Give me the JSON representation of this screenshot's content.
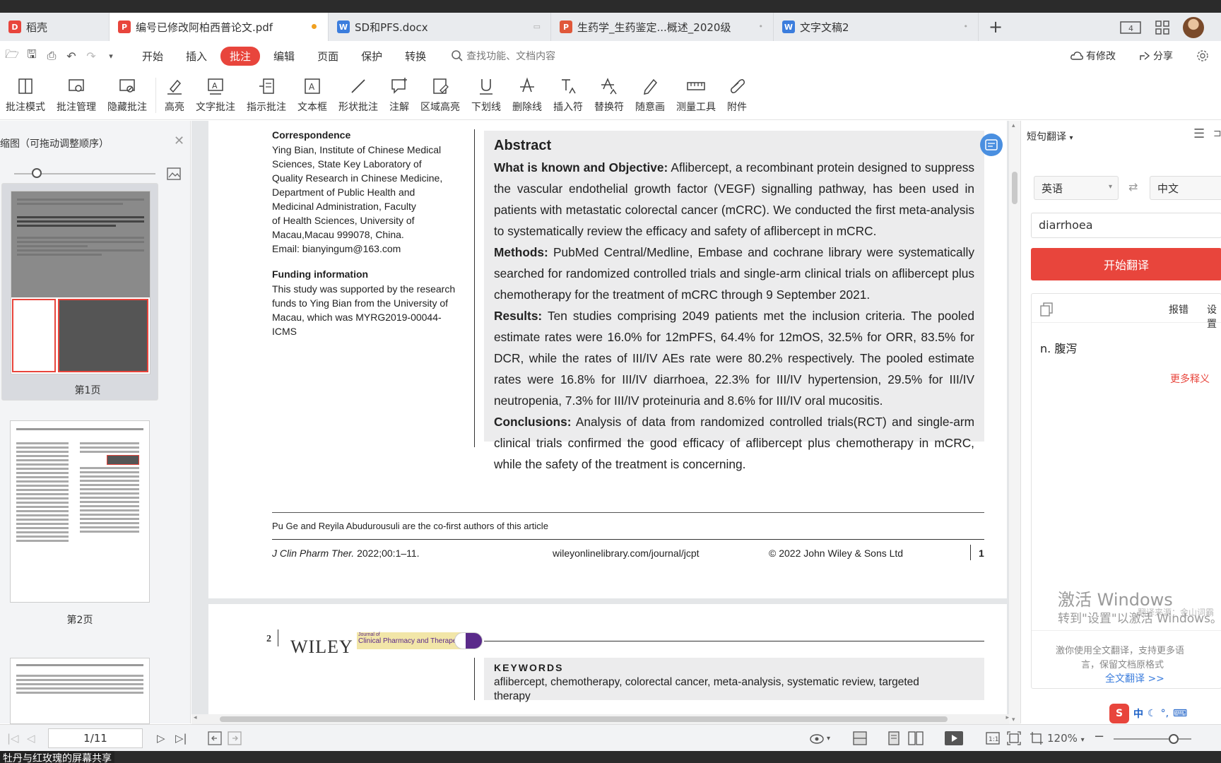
{
  "tabs": [
    {
      "label": "稻壳",
      "icon": "daoke-logo-icon",
      "color": "#e8453c",
      "active": false
    },
    {
      "label": "编号已修改阿柏西普论文.pdf",
      "icon": "pdf-icon",
      "color": "#e8453c",
      "active": true
    },
    {
      "label": "SD和PFS.docx",
      "icon": "word-icon",
      "color": "#3b7ddd",
      "active": false
    },
    {
      "label": "生药学_生药鉴定...概述_2020级",
      "icon": "ppt-icon",
      "color": "#e0583a",
      "active": false
    },
    {
      "label": "文字文稿2",
      "icon": "word-icon",
      "color": "#3b7ddd",
      "active": false
    }
  ],
  "menu": {
    "items": [
      "开始",
      "插入",
      "批注",
      "编辑",
      "页面",
      "保护",
      "转换"
    ],
    "active": "批注",
    "search_placeholder": "查找功能、文档内容",
    "modified_label": "有修改",
    "share_label": "分享"
  },
  "ribbon": [
    "批注模式",
    "批注管理",
    "隐藏批注",
    "高亮",
    "文字批注",
    "指示批注",
    "文本框",
    "形状批注",
    "注解",
    "区域高亮",
    "下划线",
    "删除线",
    "插入符",
    "替换符",
    "随意画",
    "测量工具",
    "附件"
  ],
  "left_panel": {
    "title": "缩图（可拖动调整顺序）",
    "pages": [
      {
        "label": "第1页"
      },
      {
        "label": "第2页"
      }
    ]
  },
  "document": {
    "correspondence": {
      "heading": "Correspondence",
      "lines": [
        "Ying Bian, Institute of Chinese Medical",
        "Sciences, State Key Laboratory of",
        "Quality Research in Chinese Medicine,",
        "Department of Public Health and",
        "Medicinal Administration, Faculty",
        "of Health Sciences, University of",
        "Macau,Macau 999078, China.",
        "Email: bianyingum@163.com"
      ]
    },
    "funding": {
      "heading": "Funding information",
      "lines": [
        "This study was supported by the research",
        "funds to Ying Bian from the University of",
        "Macau, which was MYRG2019-00044-",
        "ICMS"
      ]
    },
    "abstract": {
      "title": "Abstract",
      "known_label": "What is known and Objective:",
      "known_text": " Aflibercept, a recombinant protein designed to suppress the vascular endothelial growth factor (VEGF) signalling pathway, has been used in patients with metastatic colorectal cancer (mCRC). We conducted the first meta-analysis to systematically review the efficacy and safety of aflibercept in mCRC.",
      "methods_label": "Methods:",
      "methods_text": " PubMed Central/Medline, Embase and cochrane library were systematically searched for randomized controlled trials and single-arm clinical trials on aflibercept plus chemotherapy for the treatment of mCRC through 9 September 2021.",
      "results_label": "Results:",
      "results_text": " Ten studies comprising 2049 patients met the inclusion criteria. The pooled estimate rates were 16.0% for 12mPFS, 64.4% for 12mOS, 32.5% for ORR, 83.5% for DCR, while the rates of III/IV AEs rate were 80.2% respectively. The pooled estimate rates were 16.8% for III/IV diarrhoea, 22.3% for III/IV hypertension, 29.5% for III/IV neutropenia, 7.3% for III/IV proteinuria and 8.6% for III/IV oral mucositis.",
      "conclusions_label": "Conclusions:",
      "conclusions_text": " Analysis of data from randomized controlled trials(RCT) and single-arm clinical trials confirmed the good efficacy of aflibercept plus chemotherapy in mCRC, while the safety of the treatment is concerning."
    },
    "footnote": "Pu Ge and Reyila Abudurousuli are the co-first authors of this article",
    "footer": {
      "journal": "J Clin Pharm Ther.",
      "year_pages": " 2022;00:1–11.",
      "url": "wileyonlinelibrary.com/journal/jcpt",
      "copyright": "© 2022 John Wiley & Sons Ltd",
      "page": "1"
    },
    "page2": {
      "page_num": "2",
      "publisher": "WILEY",
      "journal_small": "Journal of",
      "journal_name": "Clinical Pharmacy and Therapeutics",
      "keywords_title": "KEYWORDS",
      "keywords": "aflibercept, chemotherapy, colorectal cancer, meta-analysis, systematic review, targeted",
      "keywords_cont": "therapy"
    }
  },
  "translate_panel": {
    "title": "短句翻译",
    "source_lang": "英语",
    "target_lang": "中文",
    "input_value": "diarrhoea",
    "button_label": "开始翻译",
    "report_label": "报错",
    "settings_label": "设置",
    "result": "n. 腹泻",
    "more_label": "更多释义",
    "source_note": "翻译来源：金山词霸",
    "full_text_line1": "激你使用全文翻译，支持更多语",
    "full_text_line2": "言，保留文档原格式",
    "full_text_link": "全文翻译 >>",
    "windows_line1": "激活 Windows",
    "windows_line2": "转到\"设置\"以激活 Windows。"
  },
  "statusbar": {
    "page_indicator": "1/11",
    "zoom": "120%"
  },
  "share_caption": "牡丹与红玫瑰的屏幕共享"
}
